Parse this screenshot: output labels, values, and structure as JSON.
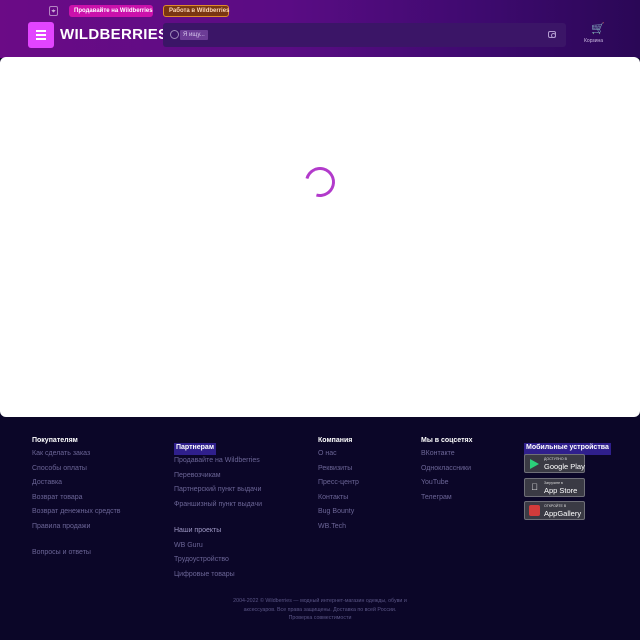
{
  "header": {
    "geo_icon": "location-pin-icon",
    "sell_label": "Продавайте на Wildberries",
    "job_label": "Работа в Wildberries",
    "logo": "WILDBERRIES",
    "search_placeholder": "Я ищу...",
    "cart_label": "Корзина",
    "colors": {
      "accent": "#cb11ab",
      "burger": "#e244ff",
      "header_start": "#6b0b86",
      "header_end": "#2a0756"
    }
  },
  "main": {
    "loading": true,
    "spinner_color": "#b23acb"
  },
  "footer": {
    "buyers": {
      "title": "Покупателям",
      "links": [
        "Как сделать заказ",
        "Способы оплаты",
        "Доставка",
        "Возврат товара",
        "Возврат денежных средств",
        "Правила продажи"
      ],
      "extra": "Вопросы и ответы"
    },
    "partners": {
      "title": "Партнерам",
      "links": [
        "Продавайте на Wildberries",
        "Перевозчикам",
        "Партнерский пункт выдачи",
        "Франшизный пункт выдачи"
      ],
      "projects_title": "Наши проекты",
      "projects": [
        "WB Guru",
        "Трудоустройство",
        "Цифровые товары"
      ]
    },
    "company": {
      "title": "Компания",
      "links": [
        "О нас",
        "Реквизиты",
        "Пресс-центр",
        "Контакты",
        "Bug Bounty",
        "WB.Tech"
      ]
    },
    "social": {
      "title": "Мы в соцсетях",
      "links": [
        "ВКонтакте",
        "Одноклассники",
        "YouTube",
        "Телеграм"
      ]
    },
    "mobile": {
      "title": "Мобильные устройства",
      "stores": [
        {
          "pre": "ДОСТУПНО В",
          "name": "Google Play",
          "icon": "google-play-icon"
        },
        {
          "pre": "Загрузите в",
          "name": "App Store",
          "icon": "apple-icon"
        },
        {
          "pre": "ОТКРОЙТЕ В",
          "name": "AppGallery",
          "icon": "appgallery-icon"
        }
      ]
    },
    "copyright": "2004-2022 © Wildberries — модный интернет-магазин одежды, обуви и аксессуаров. Все права защищены. Доставка по всей России.",
    "check_link": "Проверка совместимости"
  }
}
